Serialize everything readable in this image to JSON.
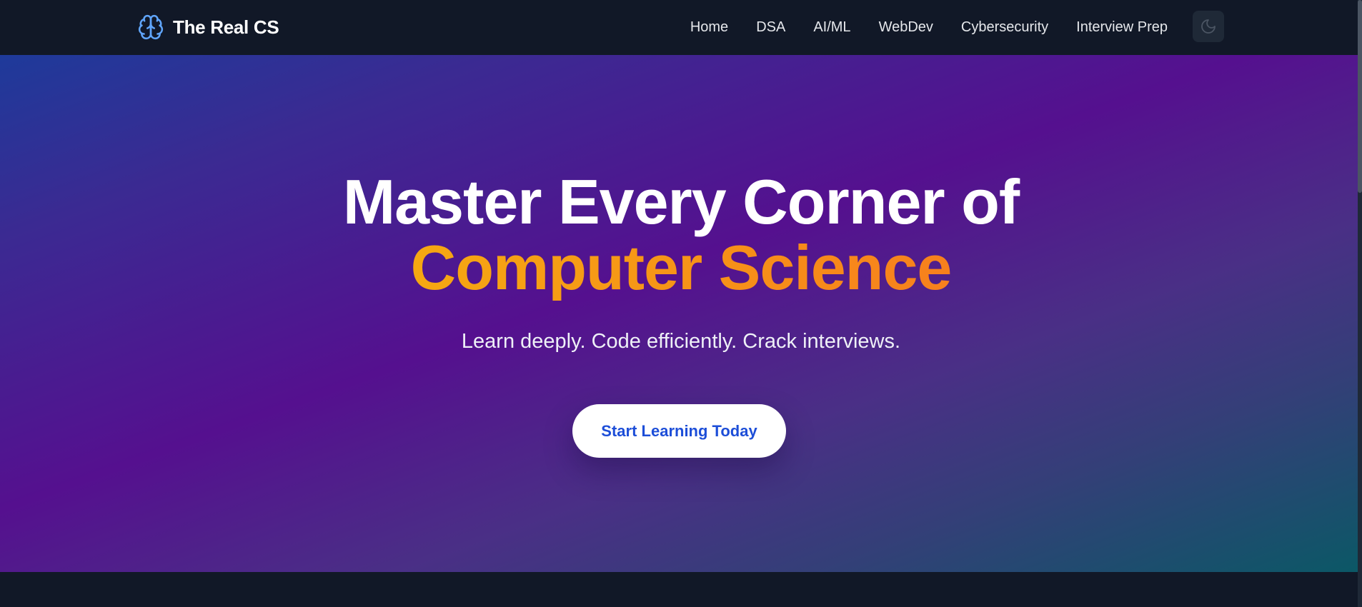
{
  "brand": {
    "name": "The Real CS",
    "icon": "brain-icon",
    "icon_color": "#60a5fa"
  },
  "nav": {
    "links": [
      {
        "label": "Home"
      },
      {
        "label": "DSA"
      },
      {
        "label": "AI/ML"
      },
      {
        "label": "WebDev"
      },
      {
        "label": "Cybersecurity"
      },
      {
        "label": "Interview Prep"
      }
    ],
    "theme_toggle_icon": "moon-icon"
  },
  "hero": {
    "title_line1": "Master Every Corner of",
    "title_line2": "Computer Science",
    "subtitle": "Learn deeply. Code efficiently. Crack interviews.",
    "cta_label": "Start Learning Today"
  },
  "colors": {
    "nav_background": "#111827",
    "accent_gradient_start": "#f6a812",
    "accent_gradient_end": "#f7801d",
    "cta_text": "#1d4ed8",
    "hero_gradient": [
      "#1e3a9a",
      "#55108f",
      "#0b5866"
    ]
  }
}
